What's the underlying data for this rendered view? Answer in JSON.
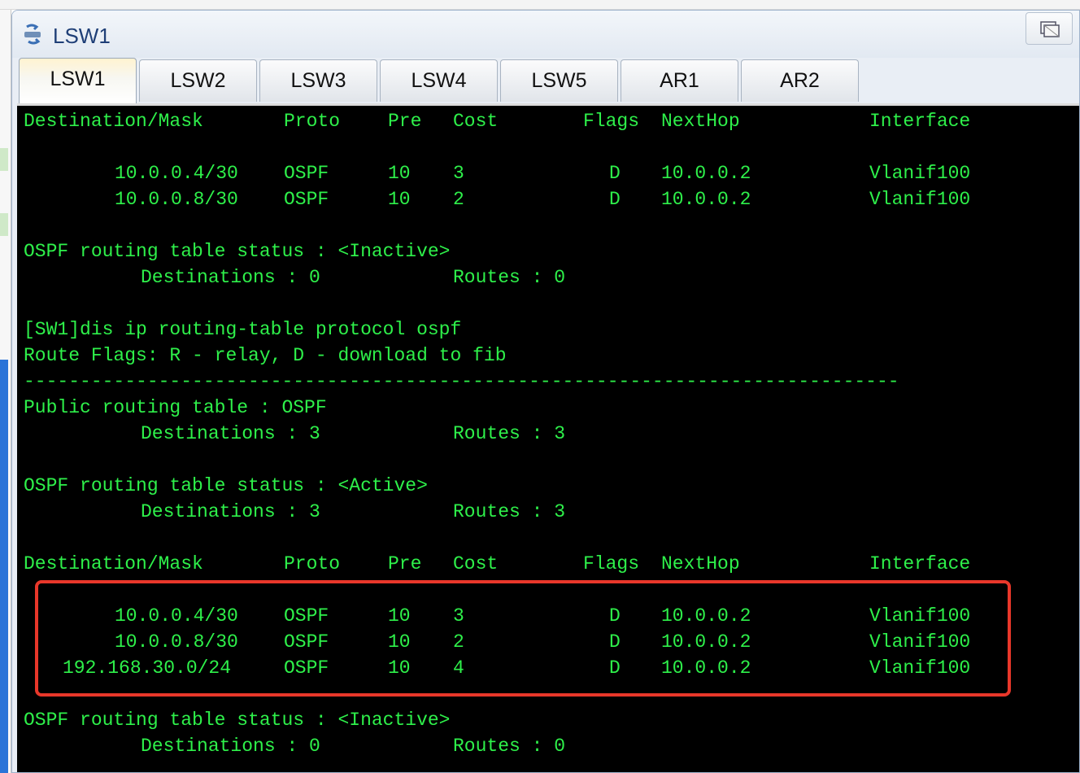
{
  "window": {
    "title": "LSW1",
    "tabs": [
      {
        "label": "LSW1",
        "active": true
      },
      {
        "label": "LSW2",
        "active": false
      },
      {
        "label": "LSW3",
        "active": false
      },
      {
        "label": "LSW4",
        "active": false
      },
      {
        "label": "LSW5",
        "active": false
      },
      {
        "label": "AR1",
        "active": false
      },
      {
        "label": "AR2",
        "active": false
      }
    ]
  },
  "colors": {
    "console_bg": "#000000",
    "console_text": "#2ef04a",
    "highlight_border": "#e8372a",
    "title_text": "#1f3f77"
  },
  "icons": {
    "app_icon": "network-switch-icon",
    "restore_icon": "restore-window-icon"
  },
  "console": {
    "header1": {
      "dest": "Destination/Mask",
      "proto": "Proto",
      "pre": "Pre",
      "cost": "Cost",
      "flags": "Flags",
      "nexthop": "NextHop",
      "iface": "Interface"
    },
    "block1_rows": [
      {
        "dest": "10.0.0.4/30",
        "proto": "OSPF",
        "pre": "10",
        "cost": "3",
        "flags": "D",
        "nexthop": "10.0.0.2",
        "iface": "Vlanif100"
      },
      {
        "dest": "10.0.0.8/30",
        "proto": "OSPF",
        "pre": "10",
        "cost": "2",
        "flags": "D",
        "nexthop": "10.0.0.2",
        "iface": "Vlanif100"
      }
    ],
    "status1": "OSPF routing table status : <Inactive>",
    "summary1": {
      "dest": "Destinations : 0",
      "routes": "Routes : 0"
    },
    "command": "[SW1]dis ip routing-table protocol ospf",
    "route_flags": "Route Flags: R - relay, D - download to fib",
    "separator": "------------------------------------------------------------------------------",
    "public_table": "Public routing table : OSPF",
    "summary2": {
      "dest": "Destinations : 3",
      "routes": "Routes : 3"
    },
    "status2": "OSPF routing table status : <Active>",
    "summary3": {
      "dest": "Destinations : 3",
      "routes": "Routes : 3"
    },
    "header2": {
      "dest": "Destination/Mask",
      "proto": "Proto",
      "pre": "Pre",
      "cost": "Cost",
      "flags": "Flags",
      "nexthop": "NextHop",
      "iface": "Interface"
    },
    "block2_rows": [
      {
        "dest": "10.0.0.4/30",
        "proto": "OSPF",
        "pre": "10",
        "cost": "3",
        "flags": "D",
        "nexthop": "10.0.0.2",
        "iface": "Vlanif100"
      },
      {
        "dest": "10.0.0.8/30",
        "proto": "OSPF",
        "pre": "10",
        "cost": "2",
        "flags": "D",
        "nexthop": "10.0.0.2",
        "iface": "Vlanif100"
      },
      {
        "dest": "192.168.30.0/24",
        "proto": "OSPF",
        "pre": "10",
        "cost": "4",
        "flags": "D",
        "nexthop": "10.0.0.2",
        "iface": "Vlanif100"
      }
    ],
    "status3": "OSPF routing table status : <Inactive>",
    "summary4": {
      "dest": "Destinations : 0",
      "routes": "Routes : 0"
    }
  }
}
